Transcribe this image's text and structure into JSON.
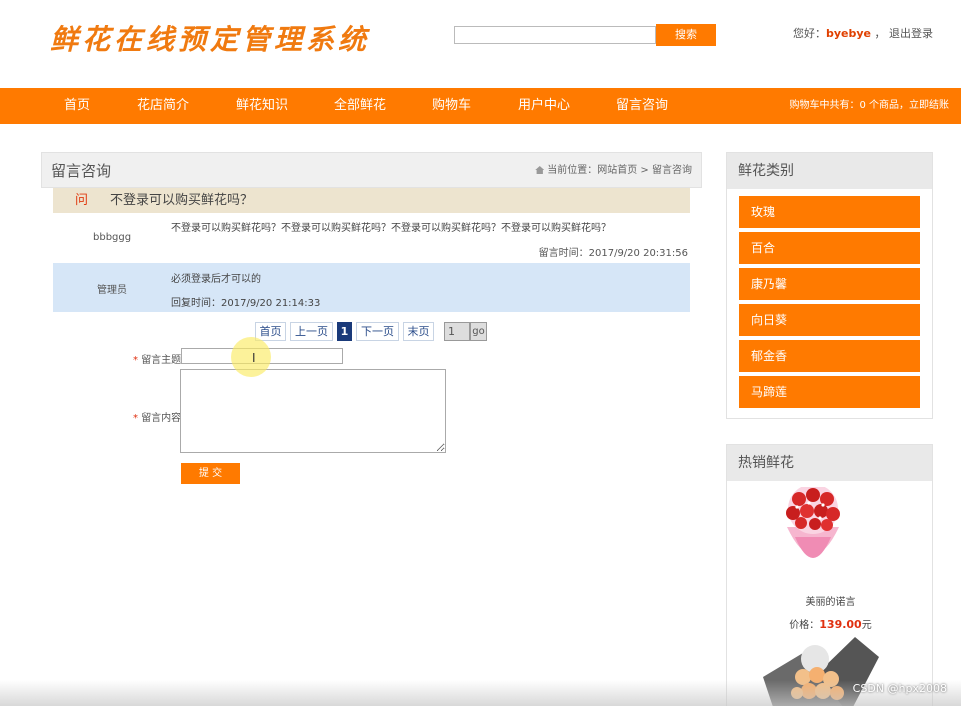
{
  "header": {
    "logo": "鲜花在线预定管理系统",
    "search_placeholder": "",
    "search_button": "搜索",
    "greeting": "您好：",
    "username": "byebye",
    "separator": "，",
    "logout": "退出登录"
  },
  "nav": {
    "items": [
      "首页",
      "花店简介",
      "鲜花知识",
      "全部鲜花",
      "购物车",
      "用户中心",
      "留言咨询"
    ],
    "cart_info": "购物车中共有：0 个商品，立即结账"
  },
  "main": {
    "title": "留言咨询",
    "breadcrumb": "当前位置：网站首页 > 留言咨询",
    "question": {
      "tag": "问",
      "title": "不登录可以购买鲜花吗？",
      "user": "bbbggg",
      "content": "不登录可以购买鲜花吗？不登录可以购买鲜花吗？不登录可以购买鲜花吗？不登录可以购买鲜花吗？",
      "time": "留言时间：2017/9/20 20:31:56"
    },
    "reply": {
      "user": "管理员",
      "content": "必须登录后才可以的",
      "time": "回复时间：2017/9/20 21:14:33"
    },
    "pager": {
      "first": "首页",
      "prev": "上一页",
      "current": "1",
      "next": "下一页",
      "last": "末页",
      "input_value": "1",
      "go": "go"
    },
    "form": {
      "required_mark": "*",
      "subject_label": "留言主题:",
      "content_label": "留言内容:",
      "subject_value": "",
      "content_value": "",
      "submit": "提 交"
    }
  },
  "sidebar": {
    "categories_title": "鲜花类别",
    "categories": [
      "玫瑰",
      "百合",
      "康乃馨",
      "向日葵",
      "郁金香",
      "马蹄莲"
    ],
    "hot_title": "热销鲜花",
    "hot_items": [
      {
        "name": "美丽的诺言",
        "price_label": "价格：",
        "price": "139.00",
        "unit": "元",
        "icon": "red-rose-bouquet-image"
      },
      {
        "name": "",
        "price_label": "",
        "price": "",
        "unit": "",
        "icon": "peach-rose-bouquet-image"
      }
    ]
  },
  "watermark": "CSDN @hpx2008",
  "colors": {
    "accent": "#ff7a00",
    "reply_bg": "#d6e6f7",
    "question_bg": "#ede4cf",
    "price": "#e03010"
  }
}
